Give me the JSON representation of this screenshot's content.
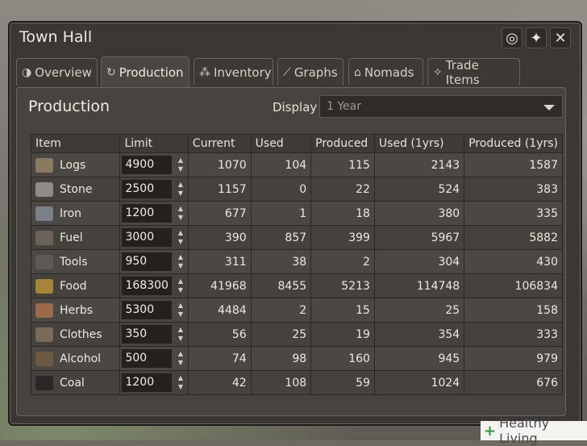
{
  "window": {
    "title": "Town Hall"
  },
  "title_controls": [
    {
      "icon": "target-icon",
      "glyph": "◎"
    },
    {
      "icon": "pin-icon",
      "glyph": "✦"
    },
    {
      "icon": "close-icon",
      "glyph": "✕"
    }
  ],
  "tabs": [
    {
      "label": "Overview",
      "icon": "eye-icon",
      "glyph": "◑",
      "active": false
    },
    {
      "label": "Production",
      "icon": "production-icon",
      "glyph": "↻",
      "active": true
    },
    {
      "label": "Inventory",
      "icon": "inventory-icon",
      "glyph": "⁂",
      "active": false
    },
    {
      "label": "Graphs",
      "icon": "graphs-icon",
      "glyph": "⟋",
      "active": false
    },
    {
      "label": "Nomads",
      "icon": "nomads-icon",
      "glyph": "⌂",
      "active": false
    },
    {
      "label": "Trade Items",
      "icon": "trade-items-icon",
      "glyph": "✧",
      "active": false
    }
  ],
  "panel": {
    "title": "Production",
    "display_label": "Display",
    "display_value": "1 Year"
  },
  "table": {
    "columns": [
      "Item",
      "Limit",
      "Current",
      "Used",
      "Produced",
      "Used (1yrs)",
      "Produced (1yrs)"
    ],
    "rows": [
      {
        "icon": "logs-icon",
        "color": "#8a7a60",
        "item": "Logs",
        "limit": "4900",
        "current": "1070",
        "used": "104",
        "produced": "115",
        "used_1yrs": "2143",
        "produced_1yrs": "1587"
      },
      {
        "icon": "stone-icon",
        "color": "#8f8c88",
        "item": "Stone",
        "limit": "2500",
        "current": "1157",
        "used": "0",
        "produced": "22",
        "used_1yrs": "524",
        "produced_1yrs": "383"
      },
      {
        "icon": "iron-icon",
        "color": "#7b8088",
        "item": "Iron",
        "limit": "1200",
        "current": "677",
        "used": "1",
        "produced": "18",
        "used_1yrs": "380",
        "produced_1yrs": "335"
      },
      {
        "icon": "fuel-icon",
        "color": "#6b6258",
        "item": "Fuel",
        "limit": "3000",
        "current": "390",
        "used": "857",
        "produced": "399",
        "used_1yrs": "5967",
        "produced_1yrs": "5882"
      },
      {
        "icon": "tools-icon",
        "color": "#5d5954",
        "item": "Tools",
        "limit": "950",
        "current": "311",
        "used": "38",
        "produced": "2",
        "used_1yrs": "304",
        "produced_1yrs": "430"
      },
      {
        "icon": "food-icon",
        "color": "#a8843a",
        "item": "Food",
        "limit": "168300",
        "current": "41968",
        "used": "8455",
        "produced": "5213",
        "used_1yrs": "114748",
        "produced_1yrs": "106834"
      },
      {
        "icon": "herbs-icon",
        "color": "#9c6a4a",
        "item": "Herbs",
        "limit": "5300",
        "current": "4484",
        "used": "2",
        "produced": "15",
        "used_1yrs": "25",
        "produced_1yrs": "158"
      },
      {
        "icon": "clothes-icon",
        "color": "#7a6a58",
        "item": "Clothes",
        "limit": "350",
        "current": "56",
        "used": "25",
        "produced": "19",
        "used_1yrs": "354",
        "produced_1yrs": "333"
      },
      {
        "icon": "alcohol-icon",
        "color": "#6e5a44",
        "item": "Alcohol",
        "limit": "500",
        "current": "74",
        "used": "98",
        "produced": "160",
        "used_1yrs": "945",
        "produced_1yrs": "979"
      },
      {
        "icon": "coal-icon",
        "color": "#2a2826",
        "item": "Coal",
        "limit": "1200",
        "current": "42",
        "used": "108",
        "produced": "59",
        "used_1yrs": "1024",
        "produced_1yrs": "676"
      }
    ]
  },
  "watermark": {
    "plus": "+",
    "text": "Healthy Living"
  }
}
